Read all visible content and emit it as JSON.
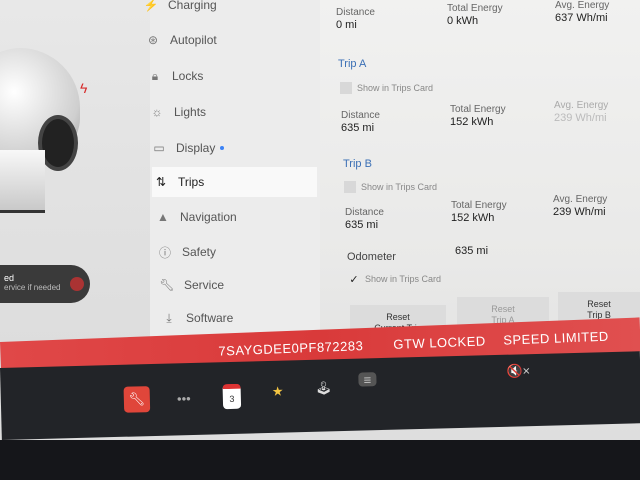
{
  "menu": {
    "items": [
      {
        "label": "Charging",
        "icon": "bolt-icon"
      },
      {
        "label": "Autopilot",
        "icon": "steering-wheel-icon"
      },
      {
        "label": "Locks",
        "icon": "lock-icon"
      },
      {
        "label": "Lights",
        "icon": "sun-icon"
      },
      {
        "label": "Display",
        "icon": "display-icon",
        "dot": true
      },
      {
        "label": "Trips",
        "icon": "trips-icon",
        "active": true
      },
      {
        "label": "Navigation",
        "icon": "navigation-icon"
      },
      {
        "label": "Safety",
        "icon": "safety-icon"
      },
      {
        "label": "Service",
        "icon": "wrench-icon"
      },
      {
        "label": "Software",
        "icon": "download-icon"
      }
    ]
  },
  "alert": {
    "line1": "ed",
    "line2": "ervice if needed"
  },
  "top_stats": {
    "distance_label": "Distance",
    "distance_value": "0 mi",
    "energy_label": "Total Energy",
    "energy_value": "0 kWh",
    "avg_label": "Avg. Energy",
    "avg_value": "637 Wh/mi"
  },
  "trip_a": {
    "title": "Trip A",
    "show_label": "Show in Trips Card",
    "distance_label": "Distance",
    "distance_value": "635 mi",
    "energy_label": "Total Energy",
    "energy_value": "152 kWh",
    "avg_label": "Avg. Energy",
    "avg_value": "239 Wh/mi"
  },
  "trip_b": {
    "title": "Trip B",
    "show_label": "Show in Trips Card",
    "distance_label": "Distance",
    "distance_value": "635 mi",
    "energy_label": "Total Energy",
    "energy_value": "152 kWh",
    "avg_label": "Avg. Energy",
    "avg_value": "239 Wh/mi"
  },
  "odometer": {
    "label": "Odometer",
    "value": "635 mi",
    "show_label": "Show in Trips Card",
    "checked": true
  },
  "buttons": {
    "reset_current": "Reset\nCurrent Trip",
    "reset_a": "Reset\nTrip A",
    "reset_b": "Reset\nTrip B"
  },
  "banner": {
    "vin": "7SAYGDEE0PF872283",
    "status1": "GTW LOCKED",
    "status2": "SPEED LIMITED"
  },
  "taskbar": {
    "calendar_day": "3",
    "dots": "•••",
    "volume": "🔇×"
  },
  "colors": {
    "banner": "#d93a3a",
    "accent": "#3a6fb5",
    "wrench_app": "#e0463a"
  }
}
